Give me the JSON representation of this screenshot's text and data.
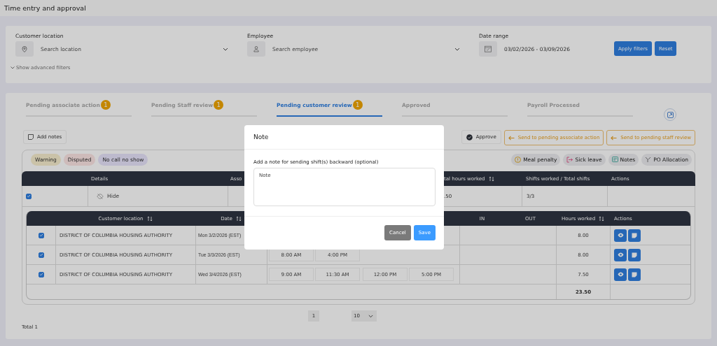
{
  "page_title": "Time entry and approval",
  "filters": {
    "fields": [
      {
        "label": "Customer location",
        "placeholder": "Search location",
        "kind": "location"
      },
      {
        "label": "Employee",
        "placeholder": "Search employee",
        "kind": "employee"
      },
      {
        "label": "Date range",
        "value": "03/02/2026 - 03/09/2026",
        "kind": "date"
      }
    ],
    "buttons": [
      "Apply filters",
      "Reset"
    ],
    "advanced_toggle": "Show advanced filters"
  },
  "tabs": [
    {
      "label": "Pending associate action",
      "count": "1",
      "selected": false
    },
    {
      "label": "Pending Staff review",
      "count": "1",
      "selected": false
    },
    {
      "label": "Pending customer review",
      "count": "1",
      "selected": true
    },
    {
      "label": "Approved",
      "selected": false
    },
    {
      "label": "Payroll Processed",
      "selected": false
    }
  ],
  "toolbar": {
    "add_notes": "Add notes",
    "approve": "Approve",
    "send_buttons": [
      "Send to pending associate action",
      "Send to pending staff review"
    ]
  },
  "status_tags": [
    {
      "label": "Warning",
      "color": "#cac2a8"
    },
    {
      "label": "Disputed",
      "color": "#cebbba"
    },
    {
      "label": "No call no show",
      "color": "#bdbacd"
    }
  ],
  "legend": [
    {
      "label": "Meal penalty",
      "kind": "meal"
    },
    {
      "label": "Sick leave",
      "kind": "sick"
    },
    {
      "label": "Notes",
      "kind": "notes"
    },
    {
      "label": "PO Allocation",
      "kind": "po"
    }
  ],
  "summary_table": {
    "columns": [
      {
        "label": "Details",
        "sortable": false
      },
      {
        "label": "Asso"
      },
      {
        "label": "tal hours worked",
        "sortable": true
      },
      {
        "label": "Shifts worked / Total shifts",
        "sortable": false
      },
      {
        "label": "Actions",
        "sortable": false
      }
    ],
    "rows": [
      {
        "checked": true,
        "details": "Hide",
        "total_hours": ".50",
        "shifts": "3/3"
      }
    ]
  },
  "shift_table": {
    "columns": [
      {
        "label": "Customer location",
        "sortable": true
      },
      {
        "label": "Date",
        "sortable": true
      },
      {
        "label": "IN",
        "sortable": false
      },
      {
        "label": "OUT",
        "sortable": false
      },
      {
        "label": "Hours worked",
        "sortable": true
      },
      {
        "label": "Actions",
        "sortable": false
      }
    ],
    "rows": [
      {
        "checked": true,
        "location": "DISTRICT OF COLUMBIA HOUSING AUTHORITY",
        "date": "Mon 3/2/2026 (EST)",
        "times": [],
        "hours": "8.00"
      },
      {
        "checked": true,
        "location": "DISTRICT OF COLUMBIA HOUSING AUTHORITY",
        "date": "Tue 3/3/2026 (EST)",
        "times": [
          "8:00 AM",
          "4:00 PM"
        ],
        "hours": "8.00"
      },
      {
        "checked": true,
        "location": "DISTRICT OF COLUMBIA HOUSING AUTHORITY",
        "date": "Wed 3/4/2026 (EST)",
        "times": [
          "9:00 AM",
          "11:30 AM",
          "12:00 PM",
          "5:00 PM"
        ],
        "hours": "7.50"
      }
    ],
    "total": "23.50"
  },
  "pagination": {
    "page": "1",
    "page_size": "10",
    "total": "Total 1"
  },
  "dialog": {
    "title": "Note",
    "label": "Add a note for sending shift(s) backward (optional)",
    "placeholder": "Note",
    "buttons": [
      {
        "label": "Cancel",
        "kind": "secondary"
      },
      {
        "label": "Save",
        "kind": "primary"
      }
    ]
  }
}
